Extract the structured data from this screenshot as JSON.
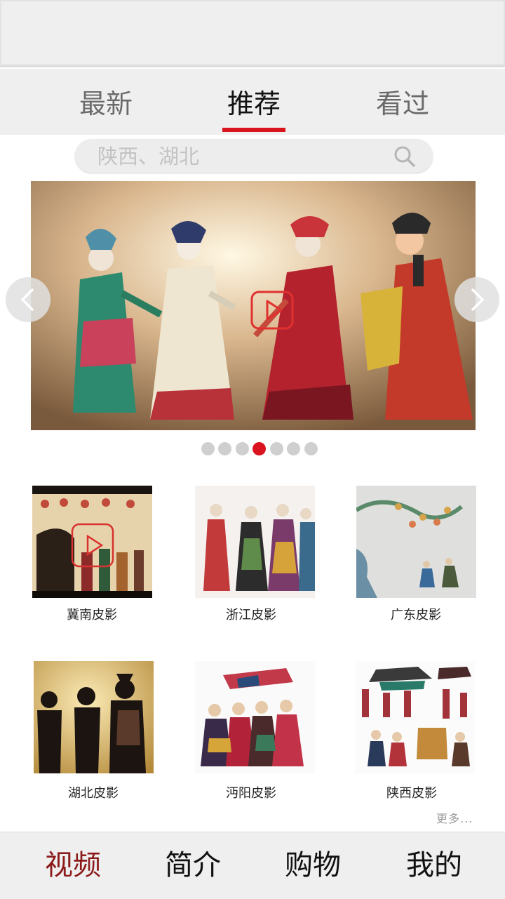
{
  "top_tabs": [
    {
      "label": "最新",
      "active": false
    },
    {
      "label": "推荐",
      "active": true
    },
    {
      "label": "看过",
      "active": false
    }
  ],
  "search": {
    "placeholder": "陕西、湖北",
    "value": ""
  },
  "banner": {
    "total_slides": 7,
    "active_slide": 4
  },
  "videos": [
    {
      "label": "冀南皮影"
    },
    {
      "label": "浙江皮影"
    },
    {
      "label": "广东皮影"
    },
    {
      "label": "湖北皮影"
    },
    {
      "label": "沔阳皮影"
    },
    {
      "label": "陕西皮影"
    }
  ],
  "more_label": "更多...",
  "bottom_nav": [
    {
      "label": "视频",
      "active": true
    },
    {
      "label": "简介",
      "active": false
    },
    {
      "label": "购物",
      "active": false
    },
    {
      "label": "我的",
      "active": false
    }
  ],
  "colors": {
    "accent": "#d9141e",
    "active_nav": "#8c1a1a",
    "bar_bg": "#efefef"
  }
}
